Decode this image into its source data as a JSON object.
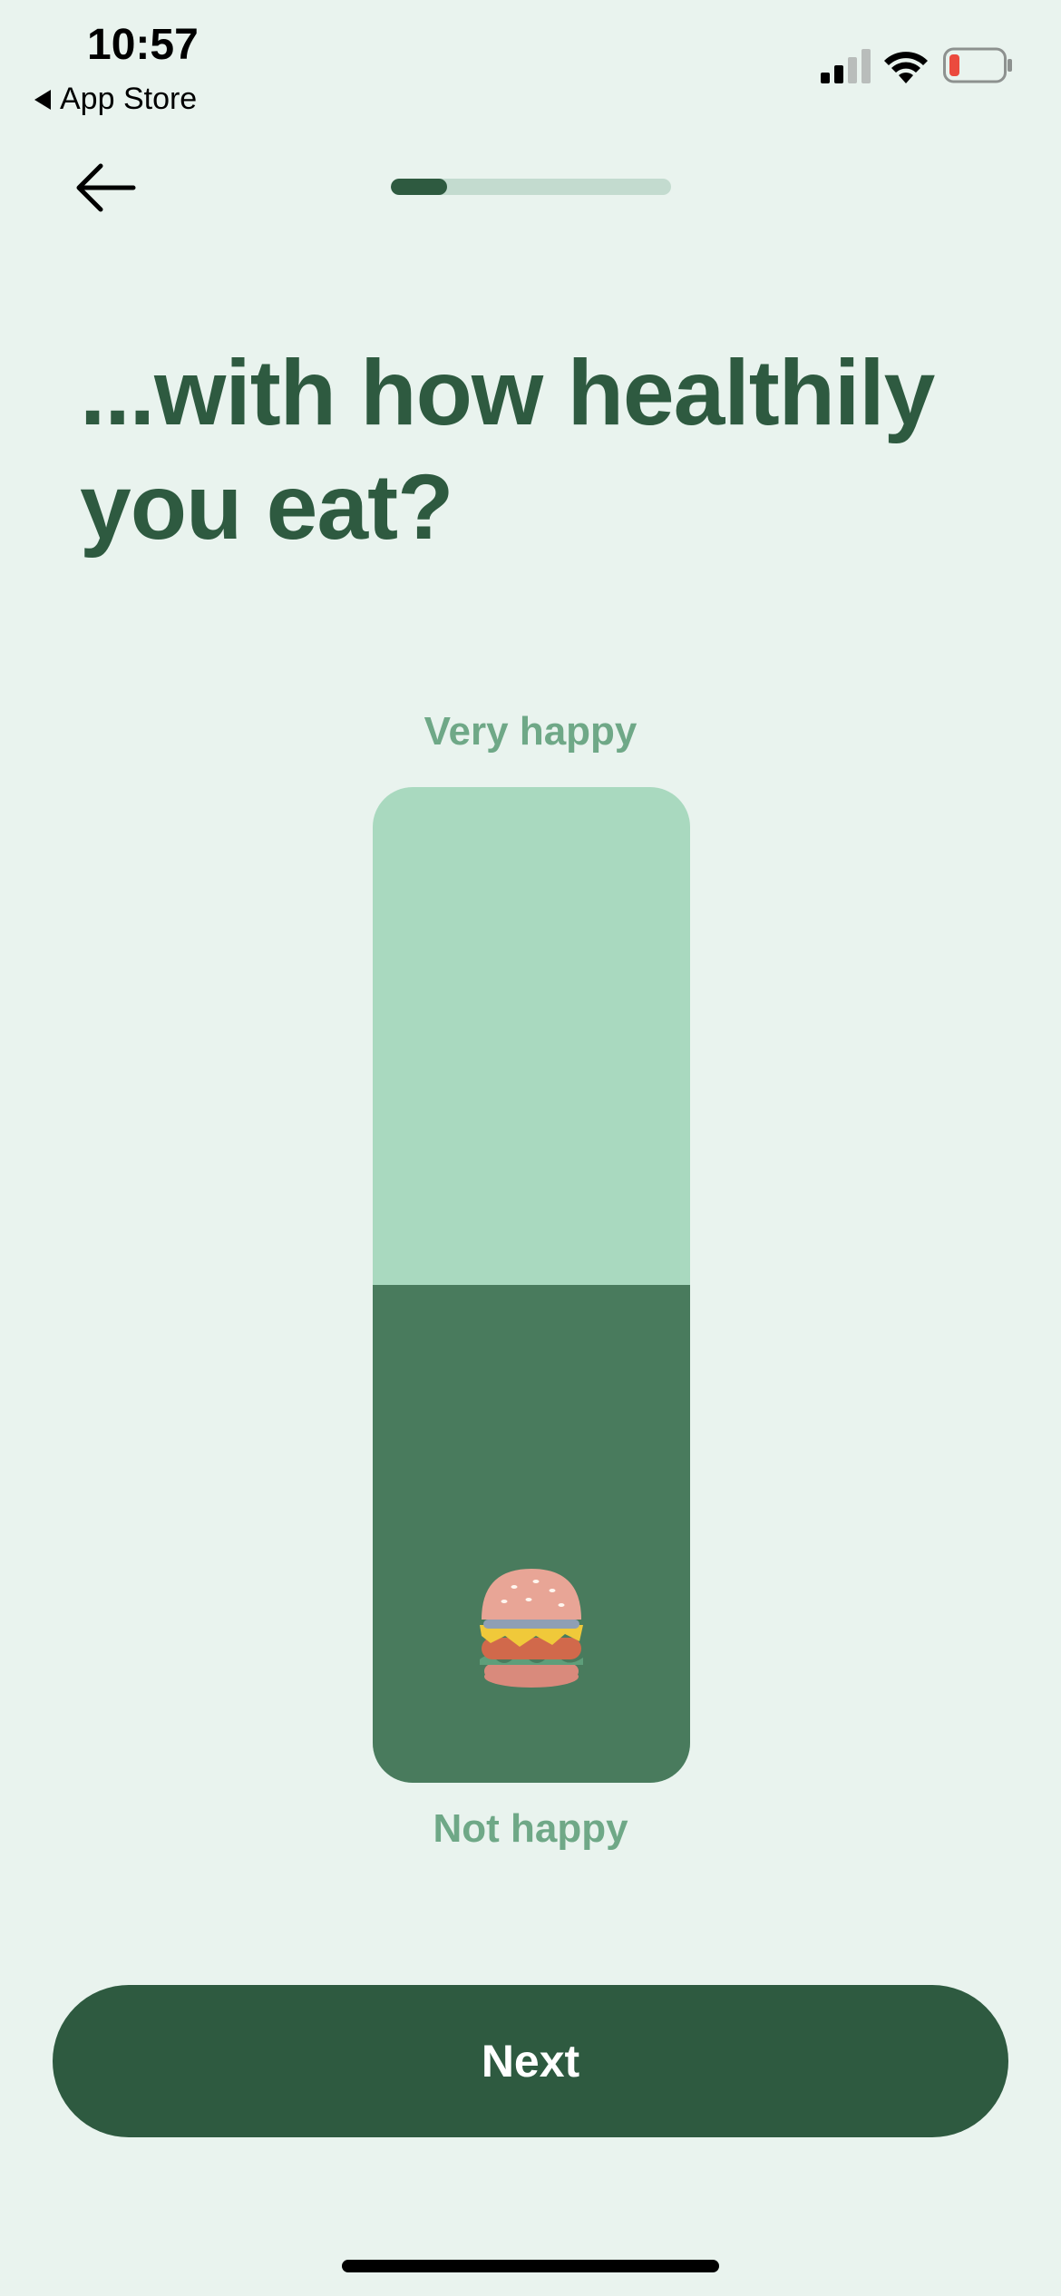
{
  "status_bar": {
    "time": "10:57",
    "back_app_label": "App Store",
    "icons": [
      "signal-icon",
      "wifi-icon",
      "battery-icon"
    ]
  },
  "nav": {
    "back_icon": "arrow-left-icon"
  },
  "progress": {
    "value": 0.2
  },
  "question": {
    "title": "...with how healthily you eat?"
  },
  "slider": {
    "top_label": "Very happy",
    "bottom_label": "Not happy",
    "value": 0.5,
    "thumb_icon": "burger-icon"
  },
  "actions": {
    "next_label": "Next"
  },
  "colors": {
    "background": "#E9F3EE",
    "primary": "#2E5A40",
    "slider_fill": "#497B5D",
    "slider_track": "#A9D9BF",
    "label": "#6FA887",
    "progress_track": "#C3DBCF"
  }
}
